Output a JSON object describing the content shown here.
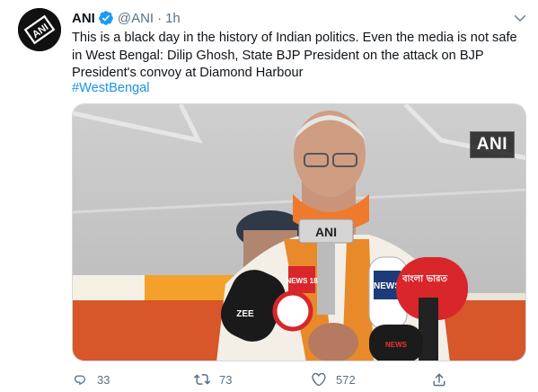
{
  "tweet": {
    "author_name": "ANI",
    "handle": "@ANI",
    "separator": "·",
    "time": "1h",
    "text": "This is a black day in the history of Indian politics. Even the media is not safe in West Bengal: Dilip Ghosh, State BJP President on the attack on BJP President's convoy at Diamond Harbour",
    "hashtag": "#WestBengal",
    "media_watermark": "ANI",
    "mic_labels": [
      "ANI",
      "NEWS",
      "ZEE",
      "NEWS 18",
      "বাংলা ভারত",
      "NEWS"
    ]
  },
  "actions": {
    "reply_count": "33",
    "retweet_count": "73",
    "like_count": "572"
  },
  "colors": {
    "accent": "#1d9bf0",
    "muted": "#5b7083",
    "hashtag": "#1b95e0"
  },
  "icons": [
    "ani-logo-icon",
    "verified-badge-icon",
    "chevron-down-icon",
    "reply-icon",
    "retweet-icon",
    "like-icon",
    "share-icon"
  ]
}
